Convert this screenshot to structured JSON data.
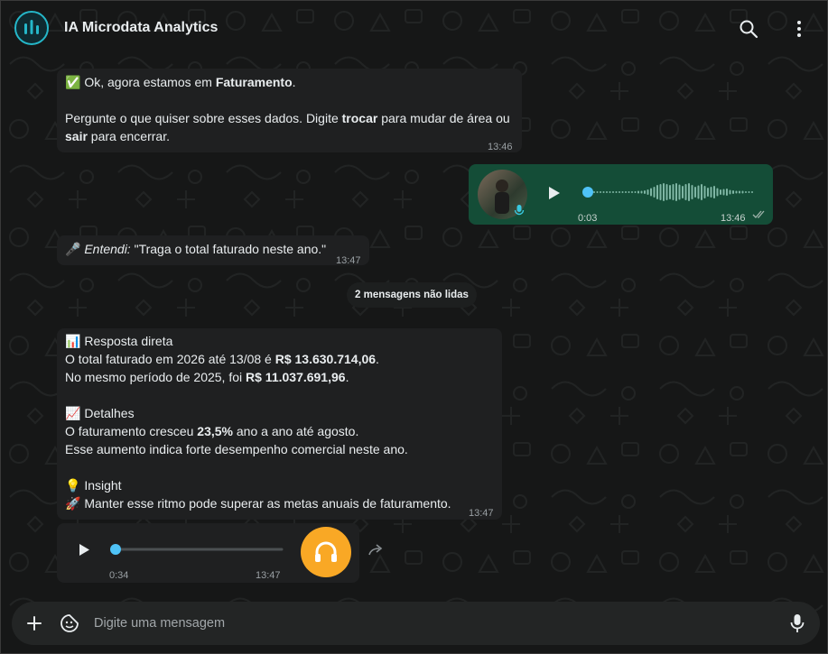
{
  "header": {
    "title": "IA Microdata Analytics",
    "icons": {
      "search": "search-icon",
      "menu": "kebab-menu-icon",
      "avatar": "bar-chart-logo-icon"
    }
  },
  "messages": {
    "m1": {
      "emoji": "✅",
      "line1_pre": "Ok, agora estamos em ",
      "line1_bold": "Faturamento",
      "line1_post": ".",
      "line2_pre": "Pergunte o que quiser sobre esses dados. Digite ",
      "line2_bold": "trocar",
      "line2_post": " para mudar de área ou",
      "line3_bold": "sair",
      "line3_post": " para encerrar.",
      "time": "13:46"
    },
    "voice_out": {
      "duration": "0:03",
      "time": "13:46",
      "progress": 0
    },
    "m2": {
      "emoji": "🎤",
      "italic": "Entendi:",
      "text": " \"Traga o total faturado neste ano.\"",
      "time": "13:47"
    },
    "unread": "2 mensagens não lidas",
    "m3": {
      "s1_emoji": "📊",
      "s1_title": "Resposta direta",
      "l1_pre": "O total faturado em 2026 até 13/08 é ",
      "l1_bold": "R$ 13.630.714,06",
      "l1_post": ".",
      "l2_pre": "No mesmo período de 2025, foi ",
      "l2_bold": "R$ 11.037.691,96",
      "l2_post": ".",
      "s2_emoji": "📈",
      "s2_title": "Detalhes",
      "l3_pre": "O faturamento cresceu ",
      "l3_bold": "23,5%",
      "l3_post": " ano a ano até agosto.",
      "l4": "Esse aumento indica forte desempenho comercial neste ano.",
      "s3_emoji": "💡",
      "s3_title": "Insight",
      "l5_emoji": "🚀",
      "l5": "Manter esse ritmo pode superar as metas anuais de faturamento.",
      "time": "13:47"
    },
    "voice_in": {
      "duration": "0:34",
      "time": "13:47",
      "progress": 0
    }
  },
  "composer": {
    "placeholder": "Digite uma mensagem"
  },
  "colors": {
    "accent": "#21c063",
    "outgoing_bubble": "#144d37",
    "incoming_bubble": "#1f2021",
    "voice_badge": "#f9a825",
    "logo_ring": "#25b7c9"
  }
}
